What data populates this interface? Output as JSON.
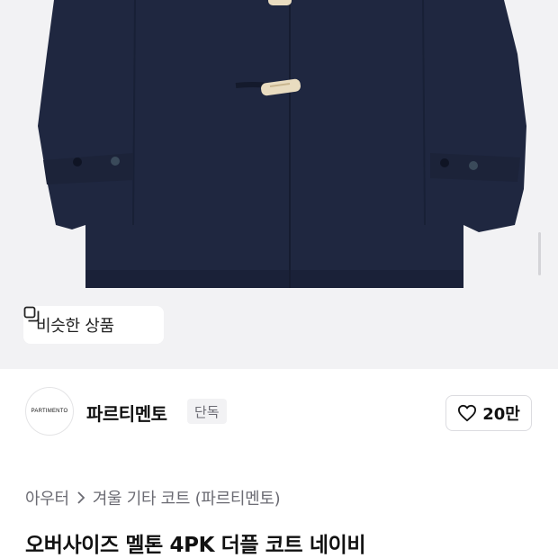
{
  "hero": {
    "similar_button_label": "비슷한 상품",
    "similar_icon": "similar-items-icon",
    "product_colors": {
      "coat": "#1f2740",
      "toggle": "#e9dcc0",
      "background": "#f2f2f4"
    }
  },
  "brand": {
    "logo_text": "PARTIMENTO",
    "name": "파르티멘토",
    "badge": "단독",
    "like_icon": "heart-icon",
    "like_count": "20만"
  },
  "breadcrumb": {
    "items": [
      "아우터",
      "겨울 기타 코트 (파르티멘토)"
    ],
    "separator_icon": "chevron-right-icon"
  },
  "product": {
    "title": "오버사이즈 멜톤 4PK 더플 코트 네이비"
  }
}
